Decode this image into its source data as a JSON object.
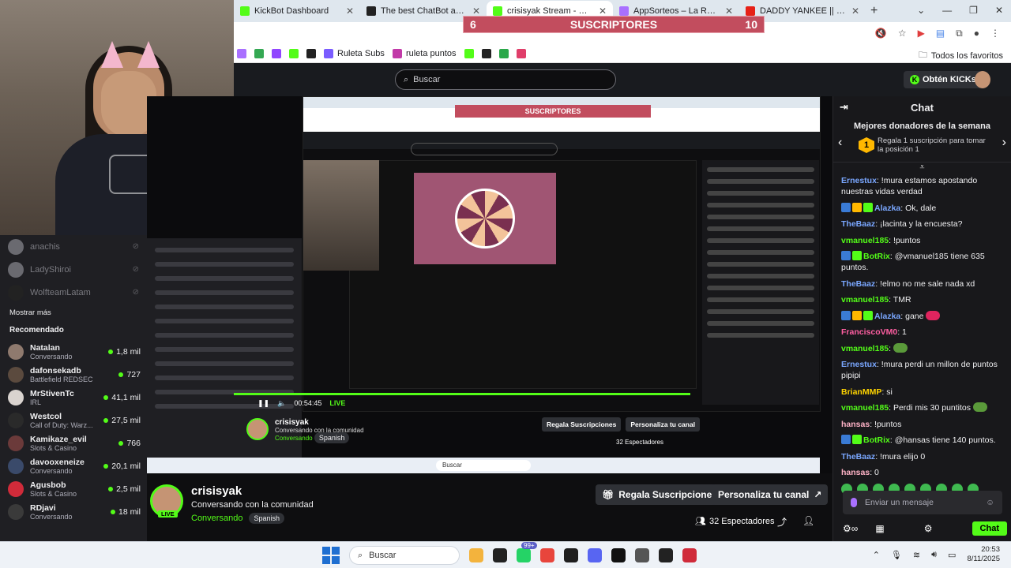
{
  "browser": {
    "tabs": [
      {
        "label": "KickBot Dashboard",
        "color": "#53fc18",
        "active": false
      },
      {
        "label": "The best ChatBot and Widgets",
        "color": "#222222",
        "active": false
      },
      {
        "label": "crisisyak Stream - Watch Live",
        "color": "#53fc18",
        "active": true
      },
      {
        "label": "AppSorteos – La Ruleta de la S",
        "color": "#a970ff",
        "active": false
      },
      {
        "label": "DADDY YANKEE || BZRP Music",
        "color": "#e62117",
        "active": false
      }
    ],
    "new_tab": "+",
    "bookmarks": [
      {
        "label": "",
        "color": "#a970ff"
      },
      {
        "label": "",
        "color": "#34a853"
      },
      {
        "label": "",
        "color": "#9146ff"
      },
      {
        "label": "",
        "color": "#53fc18"
      },
      {
        "label": "",
        "color": "#222222"
      },
      {
        "label": "Ruleta Subs",
        "color": "#7a5cff"
      },
      {
        "label": "ruleta puntos",
        "color": "#c23aa8"
      },
      {
        "label": "",
        "color": "#53fc18"
      },
      {
        "label": "",
        "color": "#222222"
      },
      {
        "label": "",
        "color": "#2aa84a"
      },
      {
        "label": "",
        "color": "#e03e6a"
      }
    ],
    "favorites_label": "Todos los favoritos"
  },
  "overlay": {
    "subs_title": "SUSCRIPTORES",
    "subs_current": "6",
    "subs_goal": "10"
  },
  "site": {
    "search_placeholder": "Buscar",
    "kicks_label": "Obtén KICKs"
  },
  "sidebar": {
    "followed": [
      {
        "name": "anachis",
        "color": "#6a6a70"
      },
      {
        "name": "LadyShiroi",
        "color": "#6a6a70"
      },
      {
        "name": "WolfteamLatam",
        "color": "#222222"
      }
    ],
    "show_more": "Mostrar más",
    "recommended_title": "Recomendado",
    "recommended": [
      {
        "name": "Natalan",
        "category": "Conversando",
        "viewers": "1,8 mil",
        "color": "#8f7a6e"
      },
      {
        "name": "dafonsekadb",
        "category": "Battlefield REDSEC",
        "viewers": "727",
        "color": "#5b4a3e"
      },
      {
        "name": "MrStivenTc",
        "category": "IRL",
        "viewers": "41,1 mil",
        "color": "#d9d3cf"
      },
      {
        "name": "Westcol",
        "category": "Call of Duty: Warz...",
        "viewers": "27,5 mil",
        "color": "#2a2a2a"
      },
      {
        "name": "Kamikaze_evil",
        "category": "Slots & Casino",
        "viewers": "766",
        "color": "#6b3a3a"
      },
      {
        "name": "davooxeneize",
        "category": "Conversando",
        "viewers": "20,1 mil",
        "color": "#3a4a6a"
      },
      {
        "name": "Agusbob",
        "category": "Slots & Casino",
        "viewers": "2,5 mil",
        "color": "#d02b3a"
      },
      {
        "name": "RDjavi",
        "category": "Conversando",
        "viewers": "18 mil",
        "color": "#3a3a3a"
      }
    ]
  },
  "video": {
    "time": "00:54:45",
    "live": "LIVE",
    "streamer": "crisisyak",
    "title": "Conversando con la comunidad",
    "category": "Conversando",
    "lang": "Spanish",
    "btn_subs": "Regala Suscripciones",
    "btn_custom": "Personaliza tu canal",
    "viewers": "32 Espectadores",
    "taskbar_search": "Buscar",
    "inner_subs": "SUSCRIPTORES"
  },
  "chat": {
    "title": "Chat",
    "donors_title": "Mejores donadores de la semana",
    "donors_rank": "1",
    "donors_text": "Regala 1 suscripción para tomar la posición 1",
    "messages": [
      {
        "user": "Ernestux",
        "color": "#7aa7ff",
        "text": "!mura estamos apostando nuestras vidas verdad",
        "badges": []
      },
      {
        "user": "Alazka",
        "color": "#7aa7ff",
        "text": "Ok, dale",
        "badges": [
          "#3a7bd5",
          "#ffb800",
          "#53fc18"
        ]
      },
      {
        "user": "TheBaaz",
        "color": "#7aa7ff",
        "text": "¡lacinta y la encuesta?",
        "badges": []
      },
      {
        "user": "vmanuel185",
        "color": "#53fc18",
        "text": "!puntos",
        "badges": []
      },
      {
        "user": "BotRix",
        "color": "#53fc18",
        "text": "@vmanuel185 tiene 635 puntos.",
        "badges": [
          "#3a7bd5",
          "#53fc18"
        ]
      },
      {
        "user": "TheBaaz",
        "color": "#7aa7ff",
        "text": "!elmo no me sale nada xd",
        "badges": []
      },
      {
        "user": "vmanuel185",
        "color": "#53fc18",
        "text": "TMR",
        "badges": []
      },
      {
        "user": "Alazka",
        "color": "#7aa7ff",
        "text": "gane",
        "badges": [
          "#3a7bd5",
          "#ffb800",
          "#53fc18"
        ],
        "emote": "#e0245e"
      },
      {
        "user": "FranciscoVM0",
        "color": "#ff5fa2",
        "text": "1",
        "badges": []
      },
      {
        "user": "vmanuel185",
        "color": "#53fc18",
        "text": "",
        "badges": [],
        "emote": "#5a9a3a"
      },
      {
        "user": "Ernestux",
        "color": "#7aa7ff",
        "text": "!mura perdi un millon de puntos pipipi",
        "badges": []
      },
      {
        "user": "BrianMMP",
        "color": "#ffd400",
        "text": "si",
        "badges": []
      },
      {
        "user": "vmanuel185",
        "color": "#53fc18",
        "text": "Perdi mis 30 puntitos",
        "badges": [],
        "emote": "#5a9a3a"
      },
      {
        "user": "hansas",
        "color": "#ffb3c7",
        "text": "!puntos",
        "badges": []
      },
      {
        "user": "BotRix",
        "color": "#53fc18",
        "text": "@hansas tiene 140 puntos.",
        "badges": [
          "#3a7bd5",
          "#53fc18"
        ]
      },
      {
        "user": "TheBaaz",
        "color": "#7aa7ff",
        "text": "!mura elijo 0",
        "badges": []
      },
      {
        "user": "hansas",
        "color": "#ffb3c7",
        "text": "0",
        "badges": []
      }
    ],
    "input_placeholder": "Enviar un mensaje",
    "send_label": "Chat"
  },
  "taskbar": {
    "search_label": "Buscar",
    "badge": "99+",
    "time": "20:53",
    "date": "8/11/2025",
    "apps": [
      "#f3b33d",
      "#222222",
      "#25d366",
      "#e8453c",
      "#1f1f1f",
      "#5865f2",
      "#111111",
      "#555555",
      "#222222",
      "#d02b3a"
    ]
  }
}
